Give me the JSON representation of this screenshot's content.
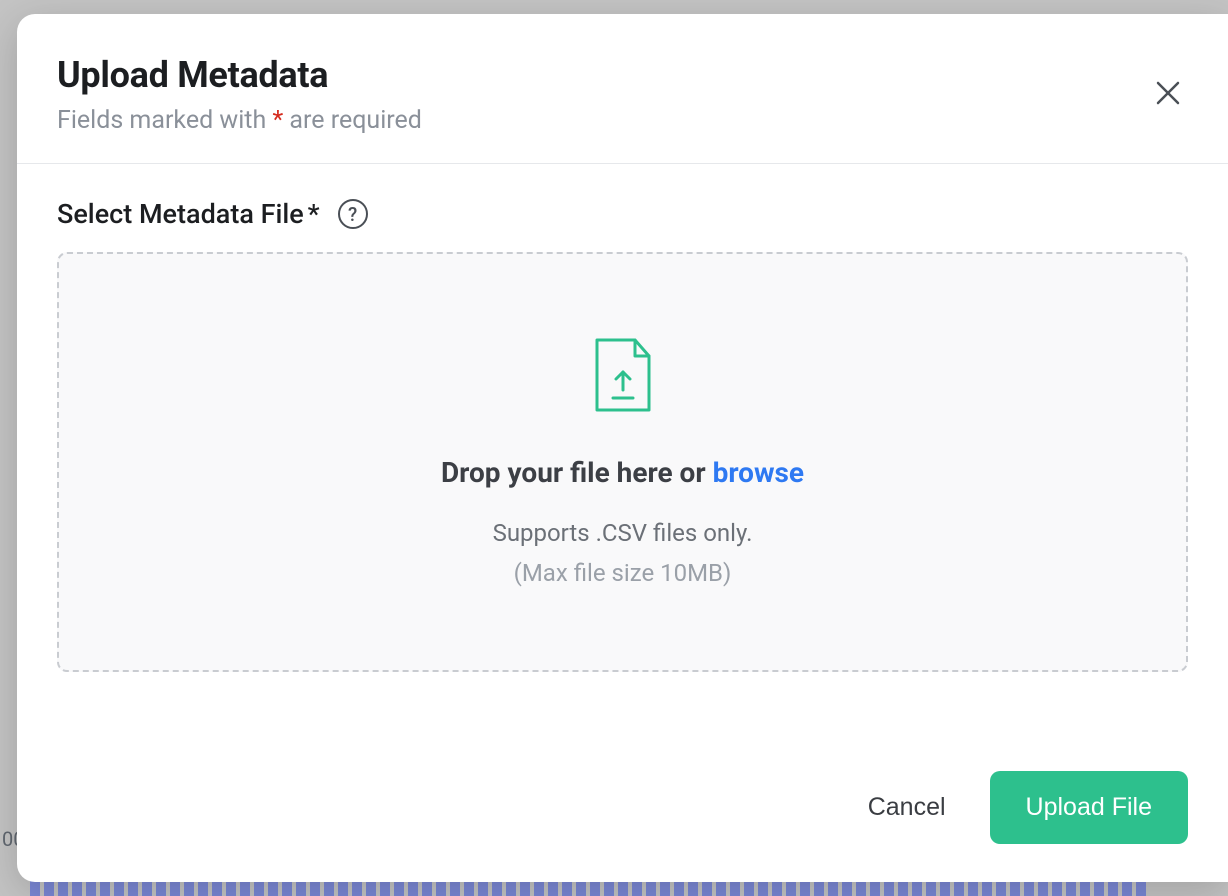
{
  "modal": {
    "title": "Upload Metadata",
    "subtitle_prefix": "Fields marked with ",
    "subtitle_asterisk": "*",
    "subtitle_suffix": " are required"
  },
  "field": {
    "label": "Select Metadata File",
    "required_mark": "*",
    "help_symbol": "?"
  },
  "dropzone": {
    "text_prefix": "Drop your file here or ",
    "browse": "browse",
    "supports": "Supports .CSV files only.",
    "max_size": "(Max file size 10MB)"
  },
  "footer": {
    "cancel": "Cancel",
    "upload": "Upload File"
  },
  "background": {
    "axis_value": "00"
  }
}
